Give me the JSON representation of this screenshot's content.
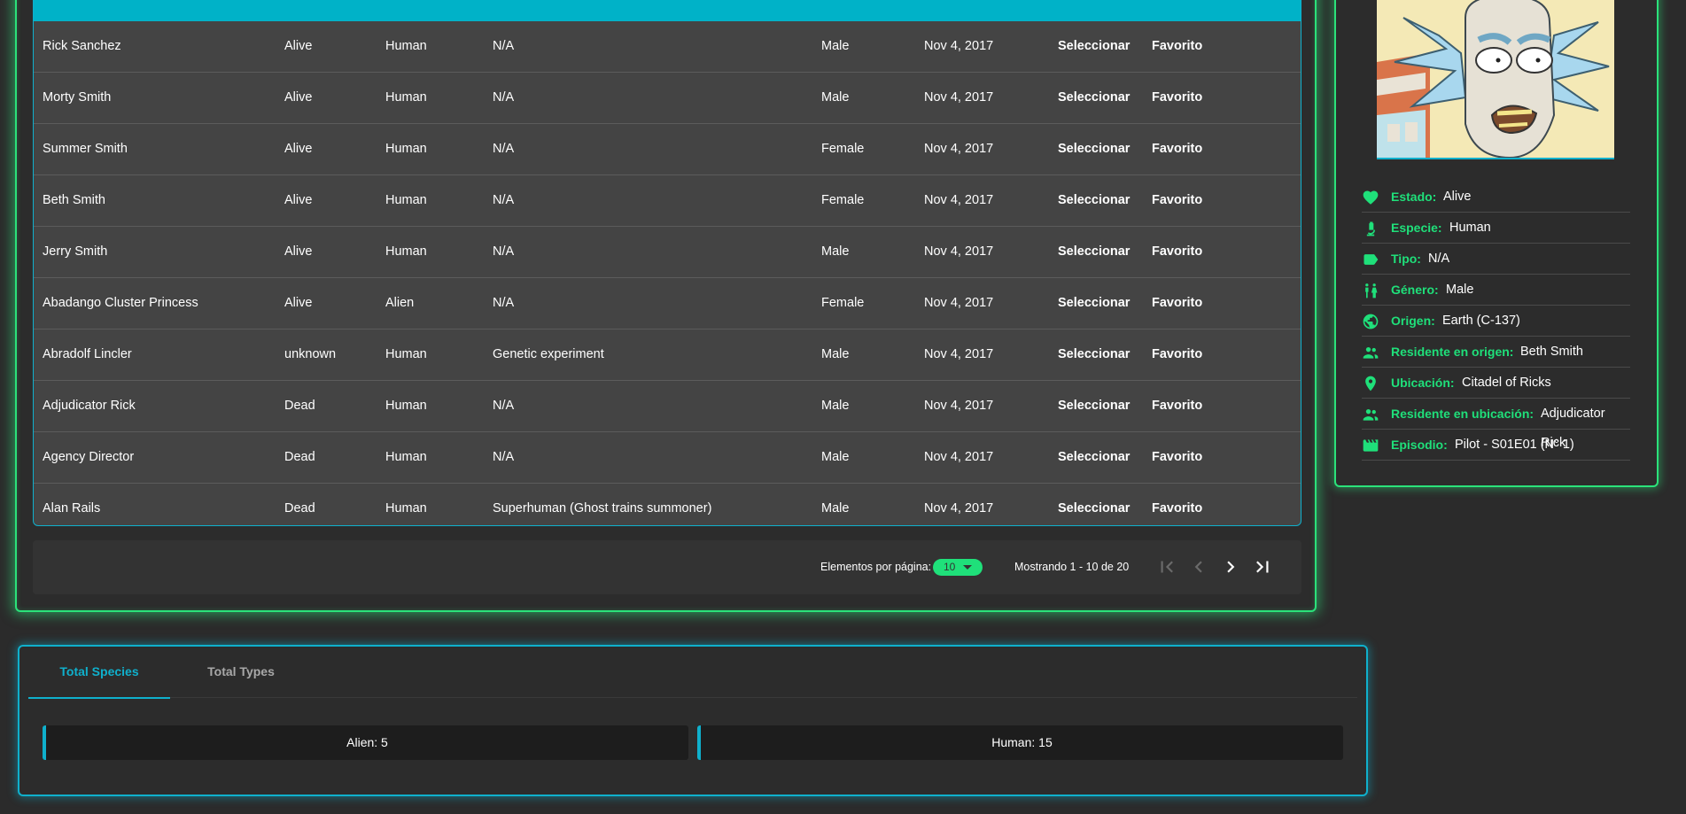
{
  "table": {
    "rows": [
      {
        "name": "Rick Sanchez",
        "status": "Alive",
        "species": "Human",
        "type": "N/A",
        "gender": "Male",
        "created": "Nov 4, 2017",
        "select": "Seleccionar",
        "favorite": "Favorito"
      },
      {
        "name": "Morty Smith",
        "status": "Alive",
        "species": "Human",
        "type": "N/A",
        "gender": "Male",
        "created": "Nov 4, 2017",
        "select": "Seleccionar",
        "favorite": "Favorito"
      },
      {
        "name": "Summer Smith",
        "status": "Alive",
        "species": "Human",
        "type": "N/A",
        "gender": "Female",
        "created": "Nov 4, 2017",
        "select": "Seleccionar",
        "favorite": "Favorito"
      },
      {
        "name": "Beth Smith",
        "status": "Alive",
        "species": "Human",
        "type": "N/A",
        "gender": "Female",
        "created": "Nov 4, 2017",
        "select": "Seleccionar",
        "favorite": "Favorito"
      },
      {
        "name": "Jerry Smith",
        "status": "Alive",
        "species": "Human",
        "type": "N/A",
        "gender": "Male",
        "created": "Nov 4, 2017",
        "select": "Seleccionar",
        "favorite": "Favorito"
      },
      {
        "name": "Abadango Cluster Princess",
        "status": "Alive",
        "species": "Alien",
        "type": "N/A",
        "gender": "Female",
        "created": "Nov 4, 2017",
        "select": "Seleccionar",
        "favorite": "Favorito"
      },
      {
        "name": "Abradolf Lincler",
        "status": "unknown",
        "species": "Human",
        "type": "Genetic experiment",
        "gender": "Male",
        "created": "Nov 4, 2017",
        "select": "Seleccionar",
        "favorite": "Favorito"
      },
      {
        "name": "Adjudicator Rick",
        "status": "Dead",
        "species": "Human",
        "type": "N/A",
        "gender": "Male",
        "created": "Nov 4, 2017",
        "select": "Seleccionar",
        "favorite": "Favorito"
      },
      {
        "name": "Agency Director",
        "status": "Dead",
        "species": "Human",
        "type": "N/A",
        "gender": "Male",
        "created": "Nov 4, 2017",
        "select": "Seleccionar",
        "favorite": "Favorito"
      },
      {
        "name": "Alan Rails",
        "status": "Dead",
        "species": "Human",
        "type": "Superhuman (Ghost trains summoner)",
        "gender": "Male",
        "created": "Nov 4, 2017",
        "select": "Seleccionar",
        "favorite": "Favorito"
      }
    ]
  },
  "paginator": {
    "items_per_page_label": "Elementos por página:",
    "items_per_page_value": "10",
    "range_label": "Mostrando 1 - 10 de 20"
  },
  "detail": {
    "items": [
      {
        "icon": "heart-icon",
        "label": "Estado:",
        "value": "Alive"
      },
      {
        "icon": "microscope-icon",
        "label": "Especie:",
        "value": "Human"
      },
      {
        "icon": "tag-icon",
        "label": "Tipo:",
        "value": "N/A"
      },
      {
        "icon": "gender-icon",
        "label": "Género:",
        "value": "Male"
      },
      {
        "icon": "globe-icon",
        "label": "Origen:",
        "value": "Earth (C-137)"
      },
      {
        "icon": "people-icon",
        "label": "Residente en origen:",
        "value": "Beth Smith"
      },
      {
        "icon": "location-pin-icon",
        "label": "Ubicación:",
        "value": "Citadel of Ricks"
      },
      {
        "icon": "people-icon",
        "label": "Residente en ubicación:",
        "value": "Adjudicator Rick"
      },
      {
        "icon": "clapperboard-icon",
        "label": "Episodio:",
        "value": "Pilot - S01E01 (N° 1)"
      }
    ]
  },
  "stats": {
    "tabs": [
      "Total Species",
      "Total Types"
    ],
    "boxes": [
      "Alien: 5",
      "Human: 15"
    ]
  },
  "colors": {
    "accent_green": "#1fe07a",
    "accent_cyan": "#00b2c8"
  }
}
